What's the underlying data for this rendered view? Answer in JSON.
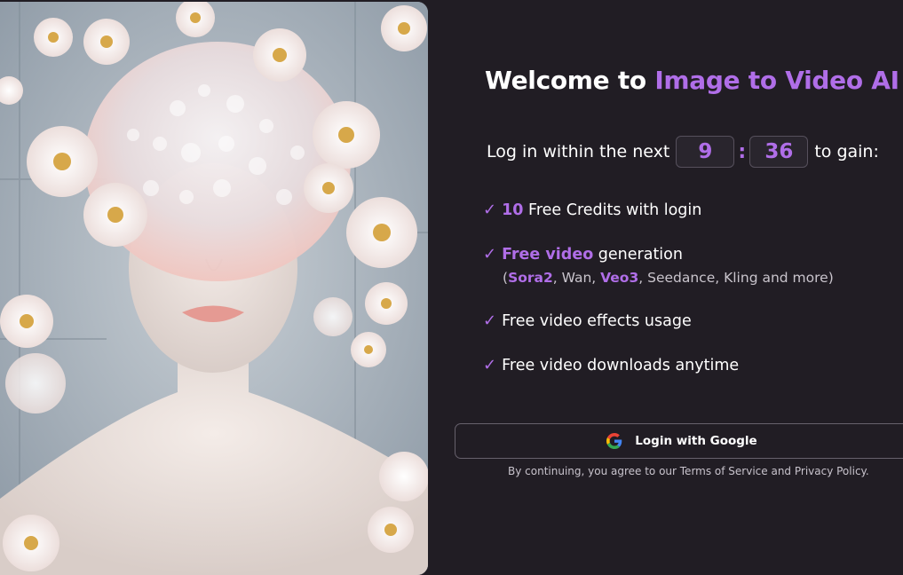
{
  "hero_image": {
    "icon": "portrait-with-flowers-image"
  },
  "title": {
    "prefix": "Welcome to",
    "brand": "Image to Video AI"
  },
  "timer": {
    "prefix": "Log in within the next",
    "minutes": "9",
    "separator": ":",
    "seconds": "36",
    "suffix": "to gain:"
  },
  "benefits": {
    "check_symbol": "✓",
    "credits": {
      "count": "10",
      "text": "Free Credits with login"
    },
    "generation": {
      "highlight": "Free video",
      "text": "generation",
      "models_open": "(",
      "model_1": "Sora2",
      "model_sep_1": ", Wan, ",
      "model_2": "Veo3",
      "models_rest": ", Seedance, Kling and more)"
    },
    "effects": "Free video effects usage",
    "downloads": "Free video downloads anytime"
  },
  "login": {
    "google_label": "Login with Google",
    "icon": "google-icon"
  },
  "disclaimer": "By continuing, you agree to our Terms of Service and Privacy Policy.",
  "colors": {
    "background": "#211d24",
    "accent": "#b06ee8",
    "text": "#ffffff"
  }
}
